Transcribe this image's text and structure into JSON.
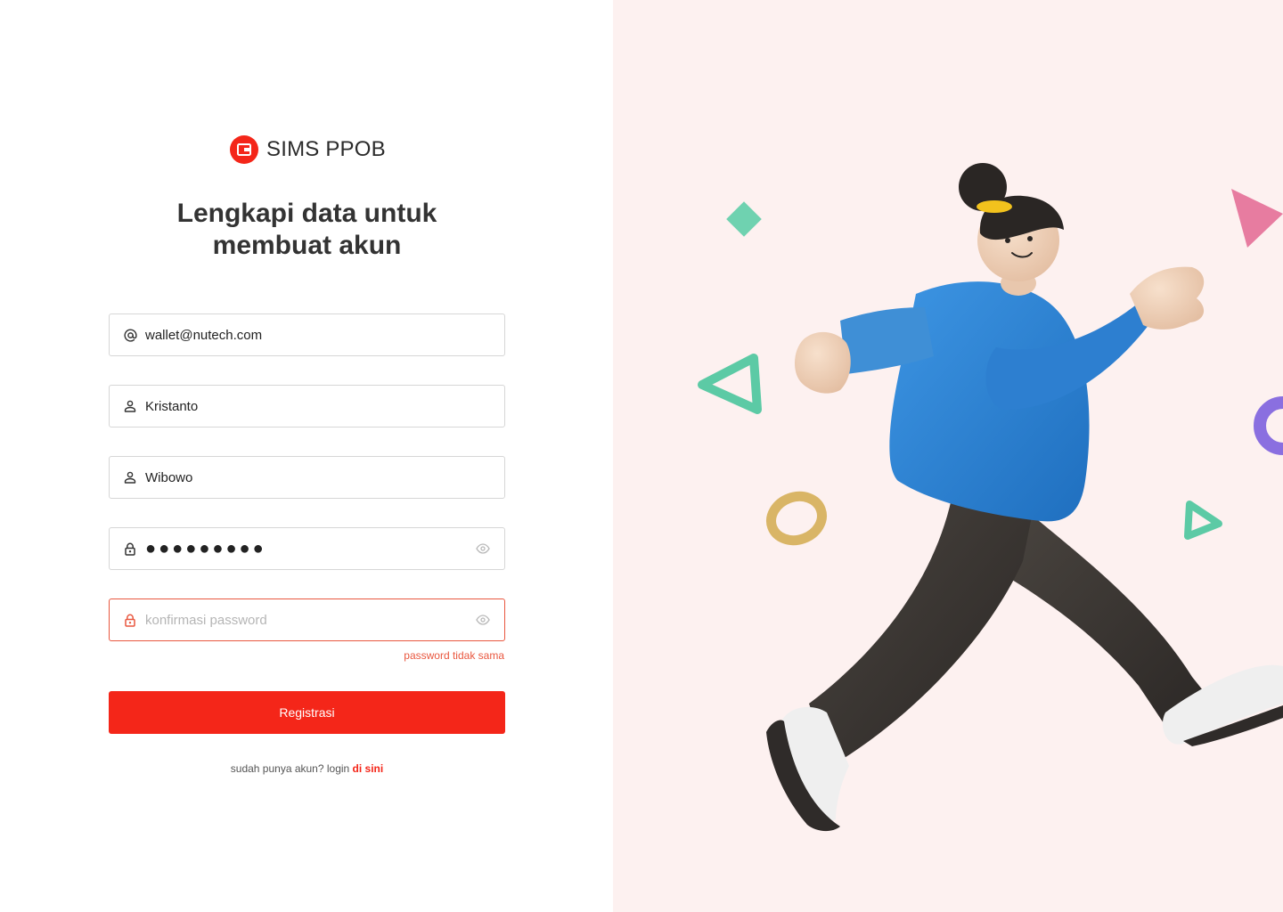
{
  "brand": {
    "name": "SIMS PPOB",
    "color": "#f42619"
  },
  "heading": {
    "line1": "Lengkapi data untuk",
    "line2": "membuat akun"
  },
  "form": {
    "email": {
      "value": "wallet@nutech.com",
      "icon": "at-icon"
    },
    "first_name": {
      "value": "Kristanto",
      "icon": "user-icon"
    },
    "last_name": {
      "value": "Wibowo",
      "icon": "user-icon"
    },
    "password": {
      "value": "●●●●●●●●●",
      "icon": "lock-icon"
    },
    "confirm_password": {
      "value": "",
      "placeholder": "konfirmasi password",
      "icon": "lock-icon"
    },
    "error_message": "password tidak sama",
    "error_color": "#e9573f",
    "submit_label": "Registrasi"
  },
  "footer": {
    "text": "sudah punya akun? login ",
    "link_label": "di sini"
  },
  "illustration": {
    "background": "#fdf1f0"
  }
}
